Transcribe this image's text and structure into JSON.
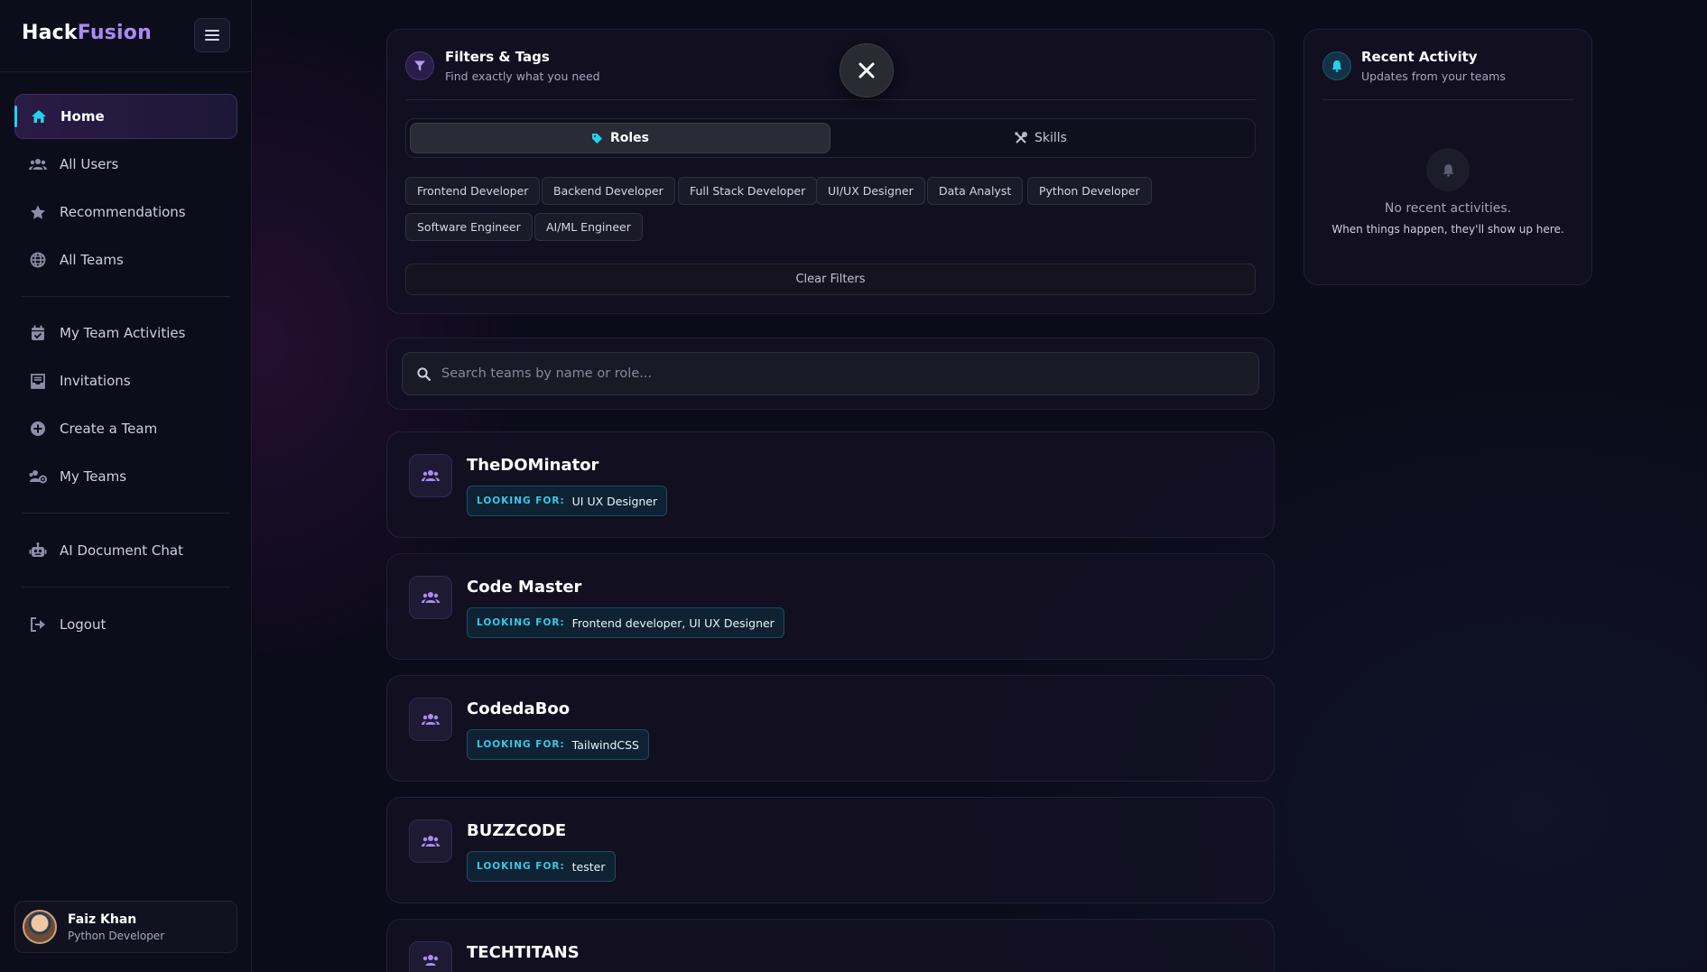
{
  "brand": {
    "part1": "Hack",
    "part2": "Fusion"
  },
  "sidebar": {
    "items": [
      {
        "label": "Home",
        "icon": "home-icon",
        "active": true
      },
      {
        "label": "All Users",
        "icon": "users-icon"
      },
      {
        "label": "Recommendations",
        "icon": "star-icon"
      },
      {
        "label": "All Teams",
        "icon": "globe-icon"
      },
      {
        "label": "My Team Activities",
        "icon": "calendar-check-icon"
      },
      {
        "label": "Invitations",
        "icon": "inbox-icon"
      },
      {
        "label": "Create a Team",
        "icon": "plus-circle-icon"
      },
      {
        "label": "My Teams",
        "icon": "users-cog-icon"
      },
      {
        "label": "AI Document Chat",
        "icon": "robot-icon"
      },
      {
        "label": "Logout",
        "icon": "logout-icon"
      }
    ],
    "user": {
      "name": "Faiz Khan",
      "role": "Python Developer"
    }
  },
  "filters": {
    "title": "Filters & Tags",
    "subtitle": "Find exactly what you need",
    "tabs": [
      {
        "label": "Roles",
        "active": true
      },
      {
        "label": "Skills",
        "active": false
      }
    ],
    "chips": [
      "Frontend Developer",
      "Backend Developer",
      "Full Stack Developer",
      "UI/UX Designer",
      "Data Analyst",
      "Python Developer",
      "Software Engineer",
      "AI/ML Engineer"
    ],
    "clear_label": "Clear Filters"
  },
  "search": {
    "placeholder": "Search teams by name or role..."
  },
  "teams": {
    "looking_label": "LOOKING FOR:",
    "items": [
      {
        "name": "TheDOMinator",
        "looking_for": "UI UX Designer"
      },
      {
        "name": "Code Master",
        "looking_for": "Frontend developer, UI UX Designer"
      },
      {
        "name": "CodedaBoo",
        "looking_for": "TailwindCSS"
      },
      {
        "name": "BUZZCODE",
        "looking_for": "tester"
      },
      {
        "name": "TECHTITANS",
        "looking_for": ""
      }
    ]
  },
  "activity": {
    "title": "Recent Activity",
    "subtitle": "Updates from your teams",
    "empty_title": "No recent activities.",
    "empty_sub": "When things happen, they'll show up here."
  },
  "colors": {
    "accent": "#22d3ee",
    "brand": "#a98bf5",
    "background": "#0c0b1a"
  }
}
